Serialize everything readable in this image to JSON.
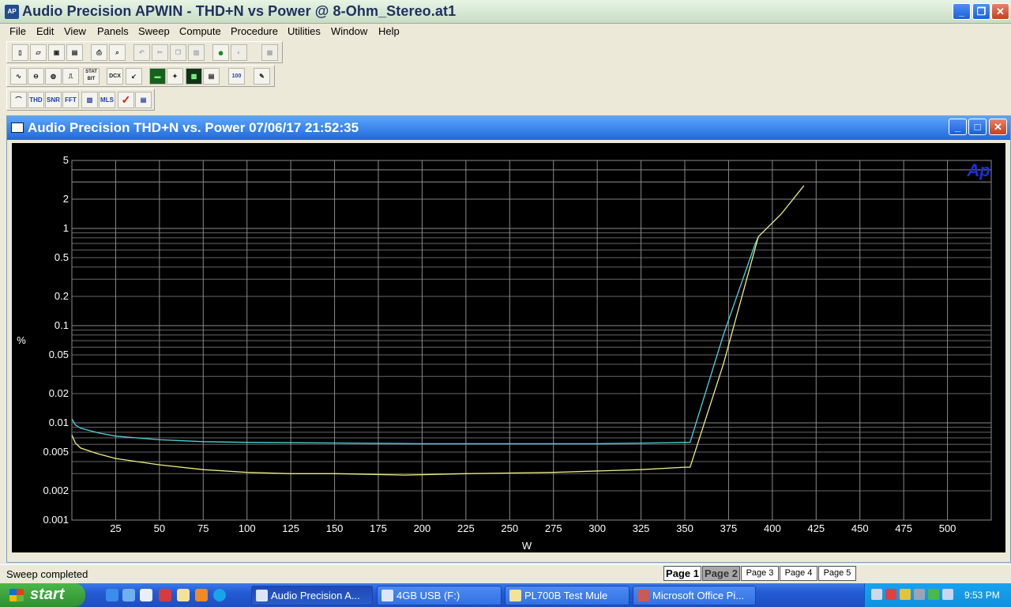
{
  "window": {
    "title": "Audio Precision APWIN - THD+N vs Power @  8-Ohm_Stereo.at1",
    "icon_text": "AP",
    "minimize": "_",
    "restore": "❐",
    "close": "✕"
  },
  "menu": [
    "File",
    "Edit",
    "View",
    "Panels",
    "Sweep",
    "Compute",
    "Procedure",
    "Utilities",
    "Window",
    "Help"
  ],
  "toolbars": {
    "row1": [
      "new-doc-icon",
      "open-icon",
      "save-icon",
      "save-all-icon",
      "print-icon",
      "print-preview-icon",
      "undo-icon",
      "cut-icon",
      "copy-icon",
      "paste-icon",
      "go-icon",
      "stop-icon",
      "disabled-panel-icon"
    ],
    "row2_labels": [
      "",
      "",
      "",
      "",
      "STAT BIT",
      "DCX",
      "",
      "",
      "",
      "",
      "",
      "100"
    ],
    "row3_labels": [
      "",
      "THD",
      "SNR",
      "FFT",
      "",
      "MLS",
      "✓",
      ""
    ]
  },
  "child_window": {
    "title": "Audio Precision  THD+N vs. Power  07/06/17 21:52:35",
    "minimize": "_",
    "maximize": "□",
    "close": "✕"
  },
  "chart_data": {
    "type": "line",
    "title": "",
    "xlabel": "W",
    "ylabel": "%",
    "xlim": [
      0,
      525
    ],
    "ylim": [
      0.001,
      5
    ],
    "y_scale": "log",
    "x_ticks": [
      25,
      50,
      75,
      100,
      125,
      150,
      175,
      200,
      225,
      250,
      275,
      300,
      325,
      350,
      375,
      400,
      425,
      450,
      475,
      500
    ],
    "y_tick_labels": [
      "5",
      "2",
      "1",
      "0.5",
      "0.2",
      "0.1",
      "0.05",
      "0.02",
      "0.01",
      "0.005",
      "0.002",
      "0.001"
    ],
    "y_ticks": [
      5,
      2,
      1,
      0.5,
      0.2,
      0.1,
      0.05,
      0.02,
      0.01,
      0.005,
      0.002,
      0.001
    ],
    "grid": true,
    "logo": "Ap",
    "series": [
      {
        "color": "#49d4dc",
        "x": [
          0,
          2,
          5,
          15,
          25,
          50,
          75,
          100,
          150,
          200,
          250,
          300,
          330,
          350,
          353,
          372,
          390,
          392
        ],
        "y": [
          0.011,
          0.0095,
          0.0088,
          0.0079,
          0.0073,
          0.0067,
          0.0064,
          0.0063,
          0.0062,
          0.0061,
          0.0061,
          0.0061,
          0.0062,
          0.0063,
          0.0063,
          0.08,
          0.68,
          0.82
        ]
      },
      {
        "color": "#eded82",
        "x": [
          0,
          2,
          5,
          15,
          25,
          50,
          75,
          100,
          125,
          150,
          190,
          225,
          275,
          325,
          350,
          353,
          372,
          392,
          405,
          418
        ],
        "y": [
          0.0075,
          0.0062,
          0.0055,
          0.0048,
          0.0043,
          0.0037,
          0.0033,
          0.0031,
          0.003,
          0.003,
          0.0029,
          0.003,
          0.0031,
          0.0033,
          0.0035,
          0.0035,
          0.04,
          0.82,
          1.4,
          2.75
        ]
      }
    ]
  },
  "status": {
    "text": "Sweep completed",
    "pages": [
      "Page 1",
      "Page 2",
      "Page 3",
      "Page 4",
      "Page 5"
    ]
  },
  "taskbar": {
    "start": "start",
    "tasks": [
      {
        "label": "Audio Precision A...",
        "active": true
      },
      {
        "label": "4GB USB (F:)",
        "active": false
      },
      {
        "label": "PL700B Test Mule",
        "active": false
      },
      {
        "label": "Microsoft Office Pi...",
        "active": false
      }
    ],
    "clock": "9:53 PM"
  },
  "colors": {
    "graph_background": "#000000",
    "grid": "#8a8a8a",
    "axis_text": "#ffffff",
    "logo": "#1a2ed8"
  }
}
